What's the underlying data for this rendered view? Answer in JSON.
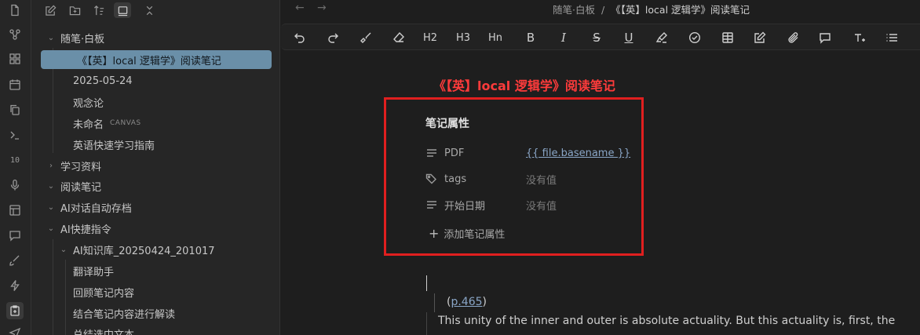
{
  "ribbon": {
    "icons": [
      "file-icon",
      "graph-icon",
      "blocks-icon",
      "calendar-icon",
      "copy-icon",
      "terminal-icon",
      "binary-icon",
      "mic-icon",
      "layout-icon",
      "chat-icon",
      "brush-icon",
      "lightning-icon",
      "export-icon",
      "send-icon"
    ]
  },
  "explorer": {
    "items": [
      {
        "label": "随笔·白板",
        "type": "folder-open"
      },
      {
        "label": "《【英】local 逻辑学》阅读笔记",
        "type": "file",
        "selected": true
      },
      {
        "label": "2025-05-24",
        "type": "file"
      },
      {
        "label": "观念论",
        "type": "file"
      },
      {
        "label": "未命名",
        "type": "file",
        "tag": "CANVAS"
      },
      {
        "label": "英语快速学习指南",
        "type": "file"
      },
      {
        "label": "学习资料",
        "type": "folder-closed"
      },
      {
        "label": "阅读笔记",
        "type": "folder-open"
      },
      {
        "label": "AI对话自动存档",
        "type": "folder-open"
      },
      {
        "label": "AI快捷指令",
        "type": "folder-open"
      },
      {
        "label": "AI知识库_20250424_201017",
        "type": "folder-open"
      },
      {
        "label": "翻译助手",
        "type": "file"
      },
      {
        "label": "回顾笔记内容",
        "type": "file"
      },
      {
        "label": "结合笔记内容进行解读",
        "type": "file"
      },
      {
        "label": "总结选中文本",
        "type": "file"
      }
    ]
  },
  "main": {
    "breadcrumb": {
      "parent": "随笔·白板",
      "separator": "/",
      "current": "《【英】local 逻辑学》阅读笔记"
    },
    "toolbar_icons": [
      "undo-icon",
      "redo-icon",
      "format-painter-icon",
      "eraser-icon",
      "h2-icon",
      "h3-icon",
      "hn-icon",
      "bold-icon",
      "italic-icon",
      "strikethrough-icon",
      "underline-icon",
      "highlight-icon",
      "checkbox-icon",
      "table-icon",
      "edit-note-icon",
      "attachment-icon",
      "comment-icon",
      "text-format-icon",
      "list-icon"
    ],
    "toolbar_text": {
      "h2": "H2",
      "h3": "H3",
      "hn": "Hn",
      "bold": "B",
      "italic": "I",
      "strike": "S",
      "underline": "U"
    },
    "note_title": "《【英】local 逻辑学》阅读笔记",
    "properties": {
      "heading": "笔记属性",
      "rows": [
        {
          "icon": "text-lines-icon",
          "key": "PDF",
          "value": "{{ file.basename }}",
          "is_link": true
        },
        {
          "icon": "tags-icon",
          "key": "tags",
          "value": "没有值"
        },
        {
          "icon": "text-lines-icon",
          "key": "开始日期",
          "value": "没有值"
        }
      ],
      "add_label": "添加笔记属性"
    },
    "body": {
      "page_link_open": "(",
      "page_link": "p.465",
      "page_link_close": ")",
      "paragraph": "This unity of the inner and outer is absolute actuality. But this actuality is, first, the"
    }
  }
}
